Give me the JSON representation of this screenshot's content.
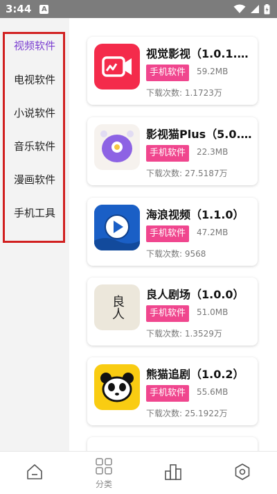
{
  "status_bar": {
    "time": "3:44",
    "notification_icon": "A"
  },
  "sidebar": {
    "items": [
      {
        "label": "视频软件",
        "active": true
      },
      {
        "label": "电视软件",
        "active": false
      },
      {
        "label": "小说软件",
        "active": false
      },
      {
        "label": "音乐软件",
        "active": false
      },
      {
        "label": "漫画软件",
        "active": false
      },
      {
        "label": "手机工具",
        "active": false
      }
    ]
  },
  "apps": [
    {
      "name": "视觉影视（1.0.1.…",
      "tag": "手机软件",
      "size": "59.2MB",
      "downloads": "下载次数: 1.1723万",
      "icon": "video-camera-icon"
    },
    {
      "name": "影视猫Plus（5.0.…",
      "tag": "手机软件",
      "size": "22.3MB",
      "downloads": "下载次数: 27.5187万",
      "icon": "cat-egg-icon"
    },
    {
      "name": "海浪视频（1.1.0）",
      "tag": "手机软件",
      "size": "47.2MB",
      "downloads": "下载次数: 9568",
      "icon": "play-icon"
    },
    {
      "name": "良人剧场（1.0.0）",
      "tag": "手机软件",
      "size": "51.0MB",
      "downloads": "下载次数: 1.3529万",
      "icon": "calligraphy-icon",
      "icon_text": "良人"
    },
    {
      "name": "熊猫追剧（1.0.2）",
      "tag": "手机软件",
      "size": "55.6MB",
      "downloads": "下载次数: 25.1922万",
      "icon": "panda-icon"
    }
  ],
  "bottom_nav": {
    "items": [
      {
        "name": "home",
        "label": ""
      },
      {
        "name": "category",
        "label": "分类"
      },
      {
        "name": "ranking",
        "label": ""
      },
      {
        "name": "settings",
        "label": ""
      }
    ]
  },
  "colors": {
    "accent": "#7b3fd1",
    "tag": "#f0468e",
    "highlight_box": "#d11f1f"
  }
}
